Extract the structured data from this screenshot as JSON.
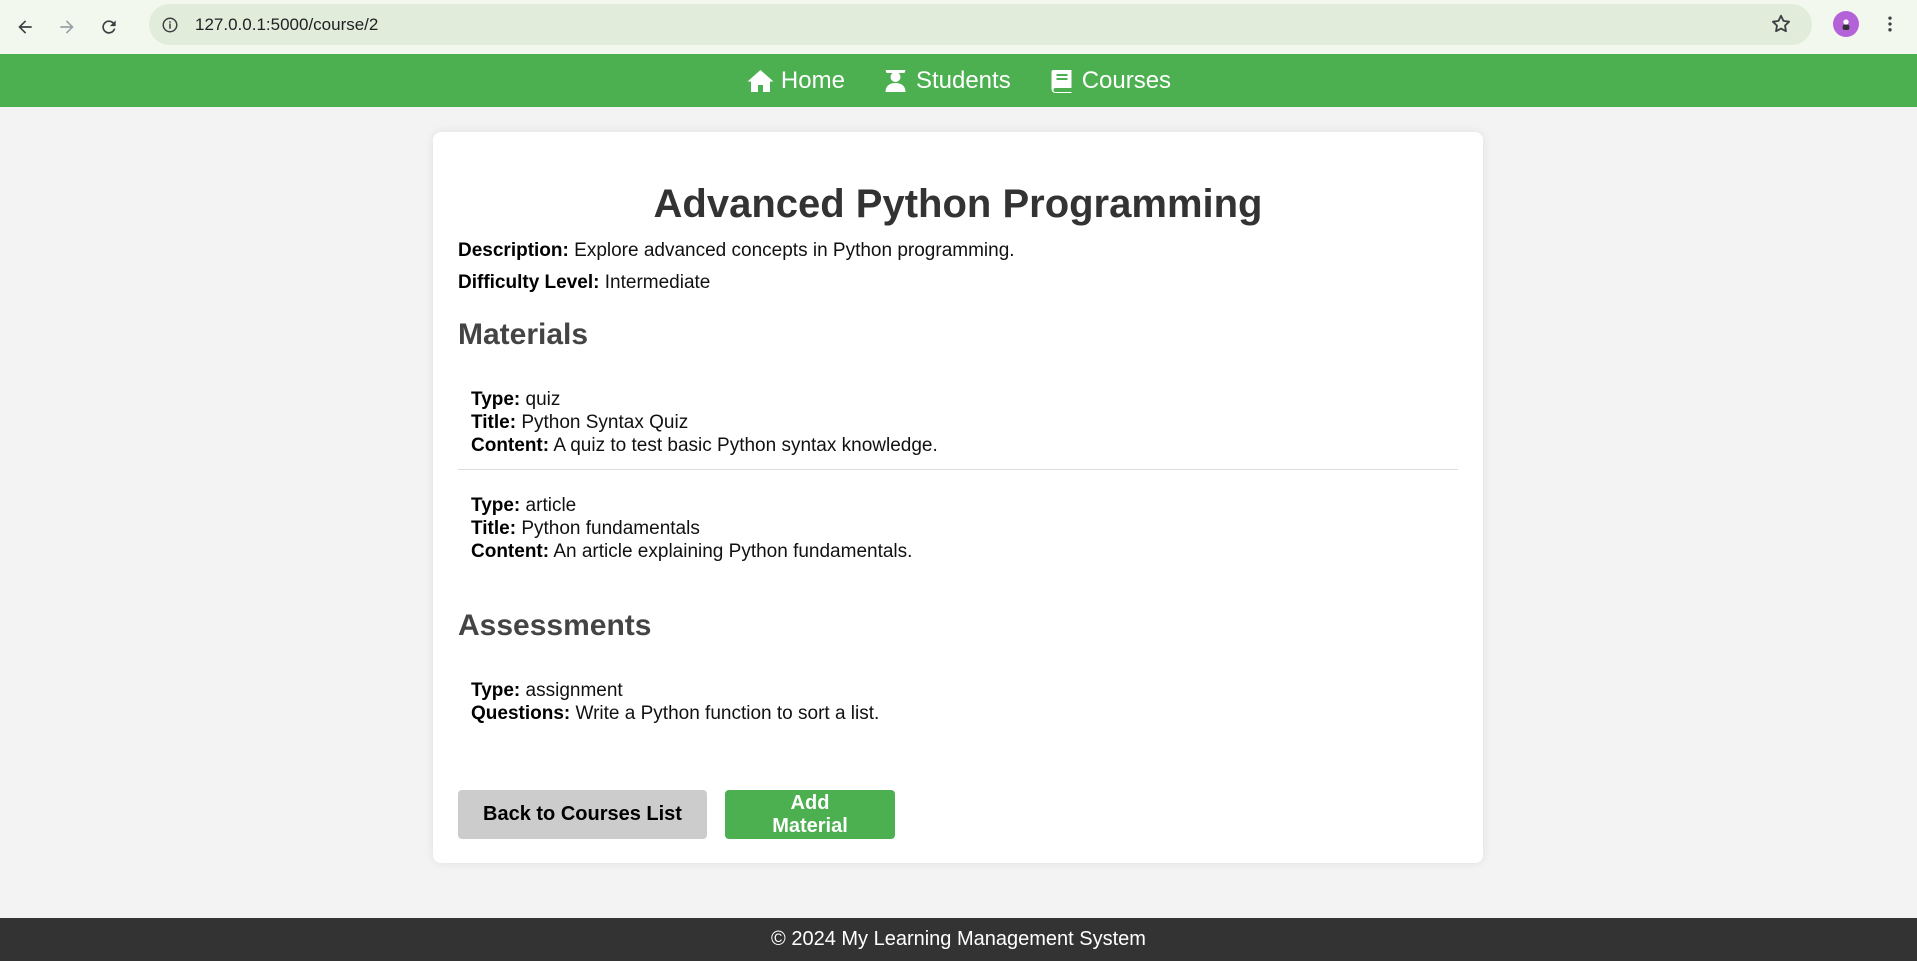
{
  "browser": {
    "url": "127.0.0.1:5000/course/2"
  },
  "nav": {
    "items": [
      {
        "label": "Home",
        "icon": "home-icon"
      },
      {
        "label": "Students",
        "icon": "graduate-icon"
      },
      {
        "label": "Courses",
        "icon": "book-icon"
      }
    ]
  },
  "course": {
    "title": "Advanced Python Programming",
    "description_label": "Description:",
    "description": "Explore advanced concepts in Python programming.",
    "difficulty_label": "Difficulty Level:",
    "difficulty": "Intermediate"
  },
  "materials": {
    "heading": "Materials",
    "type_label": "Type:",
    "title_label": "Title:",
    "content_label": "Content:",
    "items": [
      {
        "type": "quiz",
        "title": "Python Syntax Quiz",
        "content": "A quiz to test basic Python syntax knowledge."
      },
      {
        "type": "article",
        "title": "Python fundamentals",
        "content": "An article explaining Python fundamentals."
      }
    ]
  },
  "assessments": {
    "heading": "Assessments",
    "type_label": "Type:",
    "questions_label": "Questions:",
    "items": [
      {
        "type": "assignment",
        "questions": "Write a Python function to sort a list."
      }
    ]
  },
  "actions": {
    "back_label": "Back to Courses List",
    "add_label": "Add Material"
  },
  "footer": {
    "text": "© 2024 My Learning Management System"
  },
  "colors": {
    "accent": "#4caf50",
    "footer_bg": "#333333"
  }
}
